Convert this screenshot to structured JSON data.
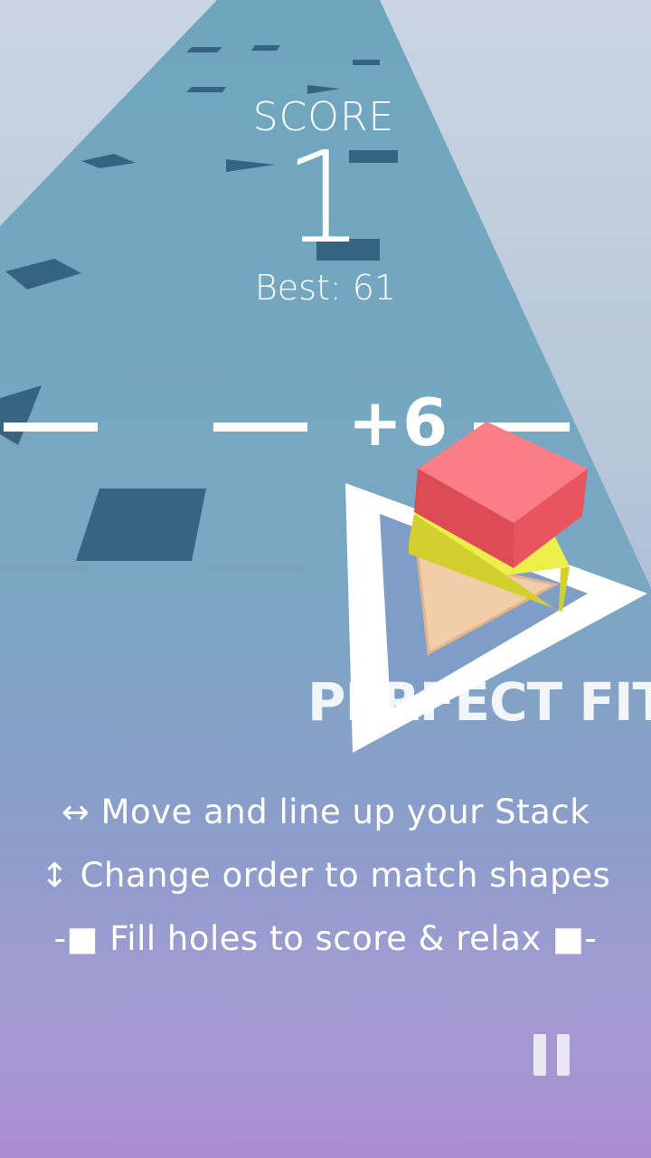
{
  "hud": {
    "score_label": "SCORE",
    "score_value": "1",
    "best_label": "Best:",
    "best_value": "61",
    "bonus": "+6",
    "feedback": "PERFECT FIT"
  },
  "instructions": {
    "line1": "↔ Move and line up your Stack",
    "line2": "↕ Change order to match shapes",
    "line3": "-■ Fill holes to score & relax ■-"
  },
  "controls": {
    "pause_icon": "pause-icon"
  },
  "stack": {
    "blocks": [
      {
        "shape": "cube",
        "color": "#f0616b"
      },
      {
        "shape": "slab",
        "color": "#eef04e"
      },
      {
        "shape": "triangle",
        "color": "#f0cba8"
      }
    ]
  },
  "colors": {
    "track": "#74a9bd",
    "hole": "#2f5d7a",
    "outline": "#ffffff"
  }
}
